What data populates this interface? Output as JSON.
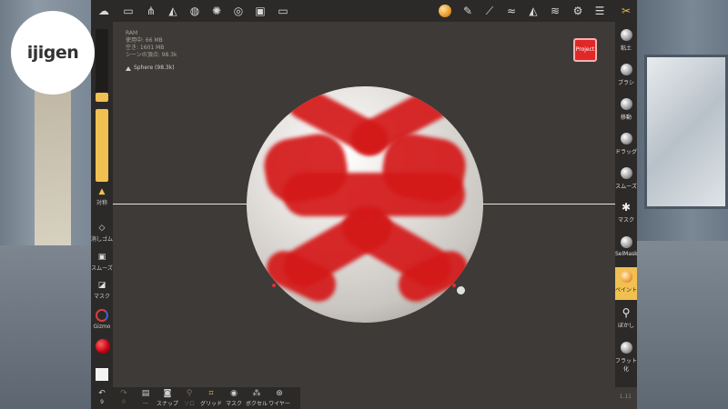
{
  "logo": {
    "text": "ijigen"
  },
  "topbar": {
    "icons": [
      "menu-icon",
      "folder-icon",
      "scene-tree-icon",
      "shading-icon",
      "globe-icon",
      "sun-icon",
      "material-icon",
      "image-icon",
      "video-icon",
      "brush-ball-icon",
      "pen-icon",
      "pipette-icon",
      "stroke-icon",
      "triangle-icon",
      "layers-icon",
      "settings-icon",
      "menu-lines-icon",
      "tools-icon"
    ]
  },
  "info": {
    "ram_label": "RAM",
    "used_memory": "使用中: 66 MB",
    "free_memory": "空き: 1601 MB",
    "scene_vertices": "シーンの頂点: 98.3k",
    "mesh_name": "Sphere (98.3k)"
  },
  "project_button": "Project",
  "left_sidebar": {
    "radius_slider": 0.12,
    "intensity_slider": 1.0,
    "symmetry_label": "対称",
    "eraser_label": "消しゴム",
    "smooth_label": "スムーズ",
    "mask_label": "マスク",
    "gizmo_label": "Gizmo"
  },
  "bottom_toolbar": [
    {
      "label": "9",
      "icon": "undo-icon",
      "enabled": true
    },
    {
      "label": "0",
      "icon": "redo-icon",
      "enabled": false
    },
    {
      "label": "…",
      "icon": "save-icon",
      "enabled": true
    },
    {
      "label": "スナップ",
      "icon": "snapshot-icon",
      "enabled": true
    },
    {
      "label": "ソロ",
      "icon": "solo-icon",
      "enabled": false
    },
    {
      "label": "グリッド",
      "icon": "grid-icon",
      "enabled": true
    },
    {
      "label": "マスク",
      "icon": "eye-mask-icon",
      "enabled": true
    },
    {
      "label": "ボクセル",
      "icon": "voxel-icon",
      "enabled": true
    },
    {
      "label": "ワイヤー",
      "icon": "wireframe-icon",
      "enabled": true
    }
  ],
  "right_tools": [
    {
      "label": "粘土",
      "active": false,
      "kind": "sphere"
    },
    {
      "label": "ブラシ",
      "active": false,
      "kind": "sphere"
    },
    {
      "label": "移動",
      "active": false,
      "kind": "sphere"
    },
    {
      "label": "ドラッグ",
      "active": false,
      "kind": "sphere"
    },
    {
      "label": "スムーズ",
      "active": false,
      "kind": "sphere"
    },
    {
      "label": "マスク",
      "active": false,
      "kind": "glyph"
    },
    {
      "label": "SelMask",
      "active": false,
      "kind": "sphere"
    },
    {
      "label": "ペイント",
      "active": true,
      "kind": "sphere"
    },
    {
      "label": "ぼかし",
      "active": false,
      "kind": "glyph"
    },
    {
      "label": "フラット化",
      "active": false,
      "kind": "sphere"
    }
  ],
  "corner_number": "1.11",
  "colors": {
    "accent": "#f0c050",
    "paint": "#d41818",
    "panel": "#2c2a28",
    "viewport": "#3d3a37"
  }
}
